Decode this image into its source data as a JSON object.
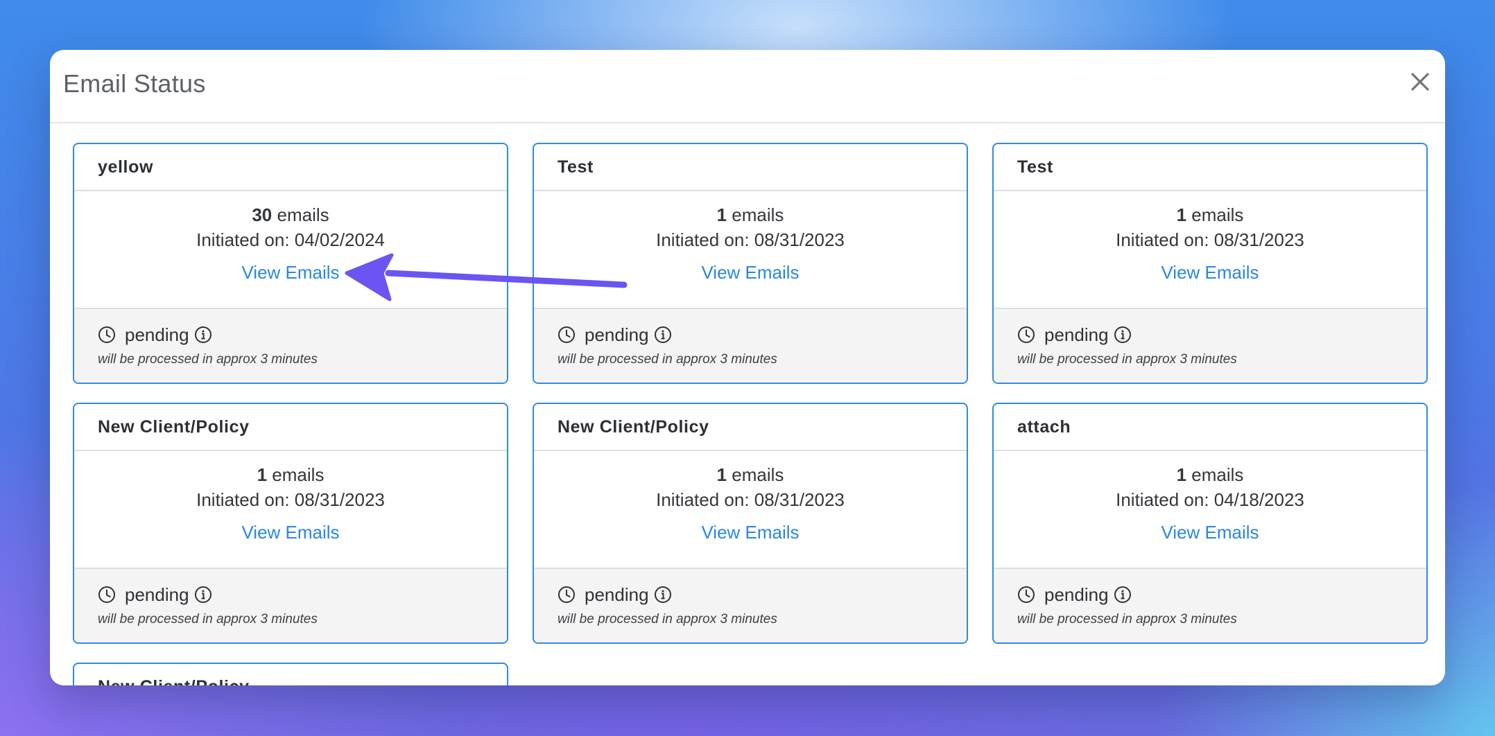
{
  "modal": {
    "title": "Email Status"
  },
  "cards": [
    {
      "name": "yellow",
      "count": "30",
      "count_suffix": "emails",
      "initiated": "Initiated on: 04/02/2024",
      "link": "View Emails",
      "status": "pending",
      "note": "will be processed in approx 3 minutes"
    },
    {
      "name": "Test",
      "count": "1",
      "count_suffix": "emails",
      "initiated": "Initiated on: 08/31/2023",
      "link": "View Emails",
      "status": "pending",
      "note": "will be processed in approx 3 minutes"
    },
    {
      "name": "Test",
      "count": "1",
      "count_suffix": "emails",
      "initiated": "Initiated on: 08/31/2023",
      "link": "View Emails",
      "status": "pending",
      "note": "will be processed in approx 3 minutes"
    },
    {
      "name": "New Client/Policy",
      "count": "1",
      "count_suffix": "emails",
      "initiated": "Initiated on: 08/31/2023",
      "link": "View Emails",
      "status": "pending",
      "note": "will be processed in approx 3 minutes"
    },
    {
      "name": "New Client/Policy",
      "count": "1",
      "count_suffix": "emails",
      "initiated": "Initiated on: 08/31/2023",
      "link": "View Emails",
      "status": "pending",
      "note": "will be processed in approx 3 minutes"
    },
    {
      "name": "attach",
      "count": "1",
      "count_suffix": "emails",
      "initiated": "Initiated on: 04/18/2023",
      "link": "View Emails",
      "status": "pending",
      "note": "will be processed in approx 3 minutes"
    }
  ],
  "partial_card": {
    "name": "New Client/Policy"
  },
  "icons": {
    "close": "close-icon",
    "clock": "clock-icon",
    "info": "info-icon",
    "annotation": "arrow-annotation"
  },
  "colors": {
    "accent": "#2f8ae6",
    "link": "#2a86e2",
    "arrow": "#6a55f2"
  }
}
